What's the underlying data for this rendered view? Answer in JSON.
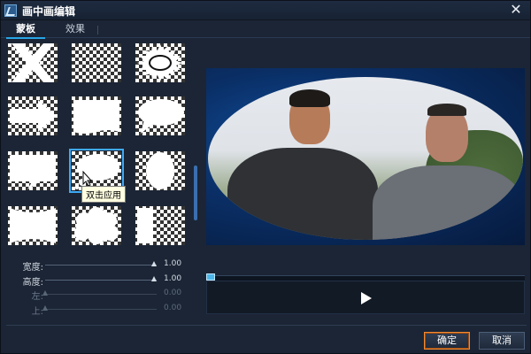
{
  "window": {
    "title": "画中画编辑"
  },
  "tabs": [
    {
      "label": "蒙板",
      "active": true
    },
    {
      "label": "效果",
      "active": false
    }
  ],
  "masks": {
    "shapes": [
      "x",
      "crescent",
      "sun-burst",
      "arrow",
      "banner-wave",
      "speech-bubble-oval",
      "speech-bubble-rect",
      "thought-bubble",
      "ellipse",
      "ribbon",
      "cloud",
      "bar"
    ],
    "selected_index": 7,
    "tooltip": "双击应用"
  },
  "sliders": [
    {
      "label": "宽度:",
      "value": "1.00",
      "level": 1.0,
      "enabled": true
    },
    {
      "label": "高度:",
      "value": "1.00",
      "level": 1.0,
      "enabled": true
    },
    {
      "label": "左:",
      "value": "0.00",
      "level": 0.0,
      "enabled": false
    },
    {
      "label": "上:",
      "value": "0.00",
      "level": 0.0,
      "enabled": false
    }
  ],
  "player": {
    "play_icon": "play-icon"
  },
  "buttons": {
    "ok": "确定",
    "cancel": "取消"
  },
  "colors": {
    "accent": "#27a6e6",
    "ok_border": "#f08a34"
  }
}
